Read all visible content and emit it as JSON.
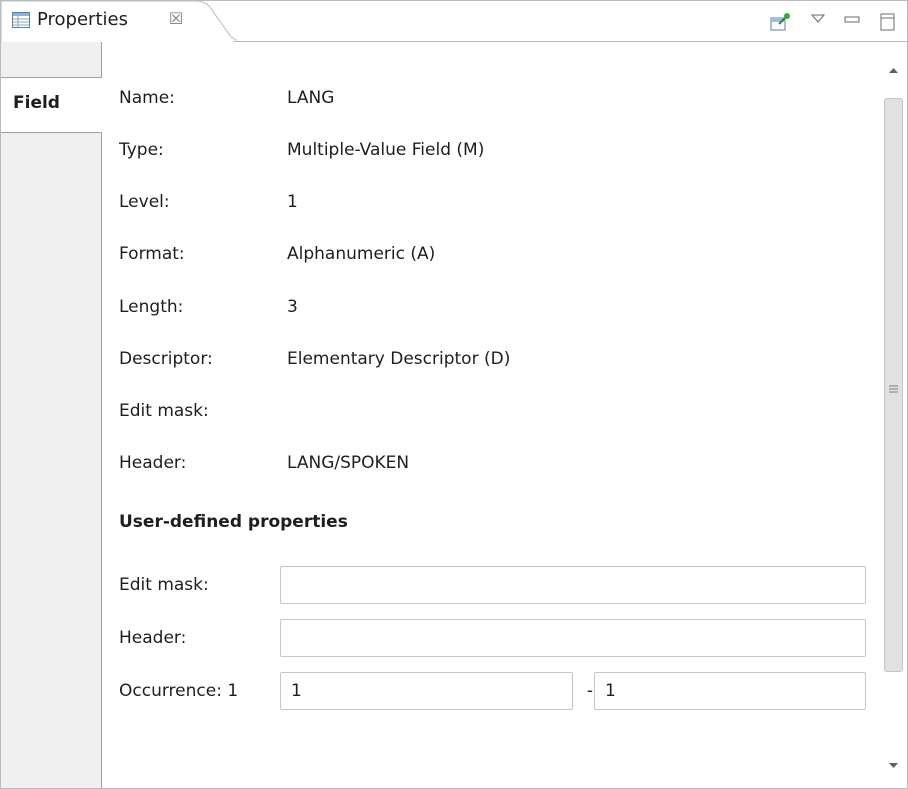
{
  "view": {
    "tab_title": "Properties",
    "tab_close_glyph": "☒",
    "toolbar": {
      "pin_icon": "pin-icon",
      "menu_icon": "view-menu-icon",
      "minimize_icon": "minimize-icon",
      "maximize_icon": "maximize-icon"
    }
  },
  "section_tab": {
    "label": "Field"
  },
  "properties": [
    {
      "label": "Name:",
      "value": "LANG"
    },
    {
      "label": "Type:",
      "value": "Multiple-Value Field  (M)"
    },
    {
      "label": "Level:",
      "value": "1"
    },
    {
      "label": "Format:",
      "value": "Alphanumeric  (A)"
    },
    {
      "label": "Length:",
      "value": "3"
    },
    {
      "label": "Descriptor:",
      "value": "Elementary Descriptor  (D)"
    },
    {
      "label": "Edit mask:",
      "value": ""
    },
    {
      "label": "Header:",
      "value": "LANG/SPOKEN"
    }
  ],
  "user_defined": {
    "heading": "User-defined properties",
    "edit_mask": {
      "label": "Edit mask:",
      "value": ""
    },
    "header": {
      "label": "Header:",
      "value": ""
    },
    "occurrence": {
      "label": "Occurrence: 1",
      "from": "1",
      "separator": "-",
      "to": "1"
    }
  },
  "colors": {
    "border": "#b7bcc3",
    "section_background": "#f0f0f0",
    "scroll_thumb": "#e1e1e1"
  }
}
